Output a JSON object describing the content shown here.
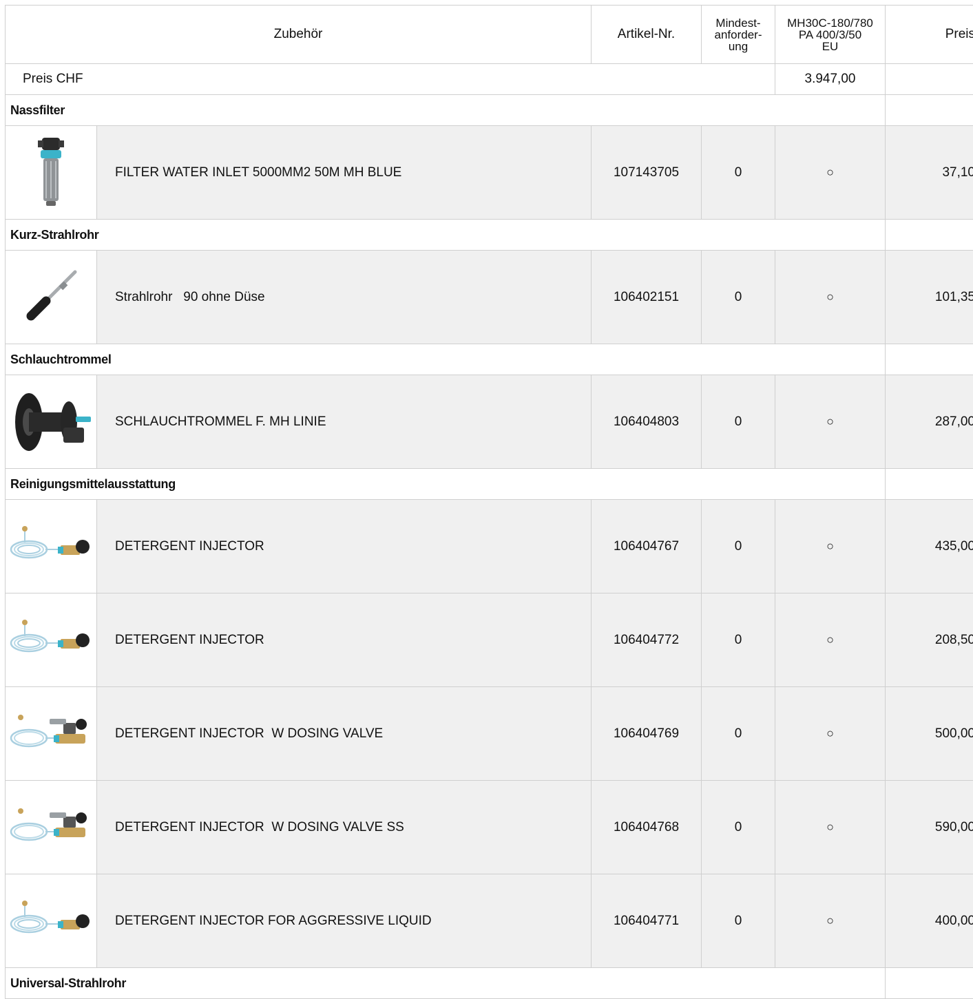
{
  "header": {
    "col_accessory": "Zubehör",
    "col_article": "Artikel-Nr.",
    "col_min_line1": "Mindest-",
    "col_min_line2": "anforder-",
    "col_min_line3": "ung",
    "col_model_line1": "MH30C-180/780",
    "col_model_line2": "PA 400/3/50",
    "col_model_line3": "EU",
    "col_price": "Preis"
  },
  "price_row": {
    "label": "Preis CHF",
    "value": "3.947,00"
  },
  "colors": {
    "border": "#cfcfcf",
    "row_bg": "#f0f0f0",
    "accent": "#3bb3c9"
  },
  "groups": [
    {
      "category": "Nassfilter",
      "items": [
        {
          "name": "FILTER WATER INLET 5000MM2 50M MH BLUE",
          "article": "107143705",
          "min": "0",
          "option": "○",
          "price": "37,10",
          "icon": "water-filter-icon"
        }
      ]
    },
    {
      "category": "Kurz-Strahlrohr",
      "items": [
        {
          "name": "Strahlrohr   90 ohne Düse",
          "article": "106402151",
          "min": "0",
          "option": "○",
          "price": "101,35",
          "icon": "lance-icon"
        }
      ]
    },
    {
      "category": "Schlauchtrommel",
      "items": [
        {
          "name": "SCHLAUCHTROMMEL F. MH LINIE",
          "article": "106404803",
          "min": "0",
          "option": "○",
          "price": "287,00",
          "icon": "hose-reel-icon"
        }
      ]
    },
    {
      "category": "Reinigungsmittelausstattung",
      "items": [
        {
          "name": "DETERGENT INJECTOR",
          "article": "106404767",
          "min": "0",
          "option": "○",
          "price": "435,00",
          "icon": "detergent-injector-icon"
        },
        {
          "name": "DETERGENT INJECTOR",
          "article": "106404772",
          "min": "0",
          "option": "○",
          "price": "208,50",
          "icon": "detergent-injector-icon"
        },
        {
          "name": "DETERGENT INJECTOR  W DOSING VALVE",
          "article": "106404769",
          "min": "0",
          "option": "○",
          "price": "500,00",
          "icon": "dosing-injector-icon"
        },
        {
          "name": "DETERGENT INJECTOR  W DOSING VALVE SS",
          "article": "106404768",
          "min": "0",
          "option": "○",
          "price": "590,00",
          "icon": "dosing-injector-icon"
        },
        {
          "name": "DETERGENT INJECTOR FOR AGGRESSIVE LIQUID",
          "article": "106404771",
          "min": "0",
          "option": "○",
          "price": "400,00",
          "icon": "detergent-injector-icon"
        }
      ]
    },
    {
      "category": "Universal-Strahlrohr",
      "items": []
    }
  ]
}
